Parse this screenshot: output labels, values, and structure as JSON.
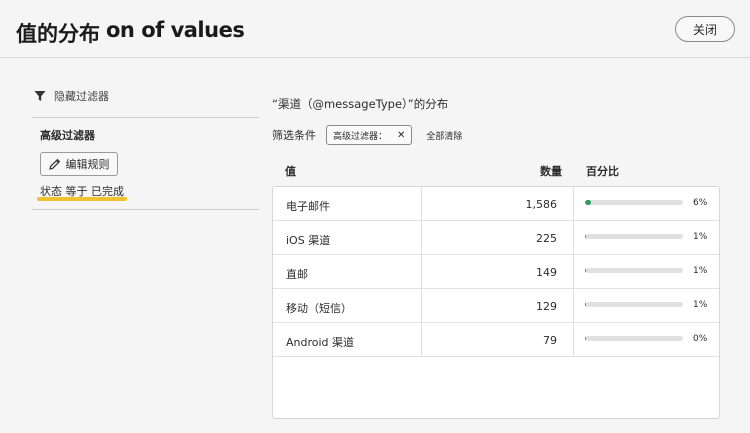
{
  "header": {
    "title_cn": "值的分布",
    "title_en": "on of values",
    "close_label": "关闭"
  },
  "sidebar": {
    "hide_filter_label": "隐藏过滤器",
    "advanced_title": "高级过滤器",
    "edit_rule_label": "编辑规则",
    "status_text": "状态 等于 已完成"
  },
  "main": {
    "distribution_title": "“渠道（@messageType）”的分布",
    "filter_label": "筛选条件",
    "chip_label": "高级过滤器：",
    "chip_close": "✕",
    "clear_all": "全部清除",
    "columns": {
      "value": "值",
      "count": "数量",
      "percent": "百分比"
    },
    "rows": [
      {
        "name": "电子邮件",
        "count": "1,586",
        "percent": "6%",
        "fraction": 0.06
      },
      {
        "name": "iOS 渠道",
        "count": "225",
        "percent": "1%",
        "fraction": 0.01
      },
      {
        "name": "直邮",
        "count": "149",
        "percent": "1%",
        "fraction": 0.01
      },
      {
        "name": "移动（短信）",
        "count": "129",
        "percent": "1%",
        "fraction": 0.01
      },
      {
        "name": "Android 渠道",
        "count": "79",
        "percent": "0%",
        "fraction": 0.004
      }
    ]
  },
  "colors": {
    "accent_green": "#2a9d5c",
    "highlight_yellow": "#f2c12e"
  }
}
